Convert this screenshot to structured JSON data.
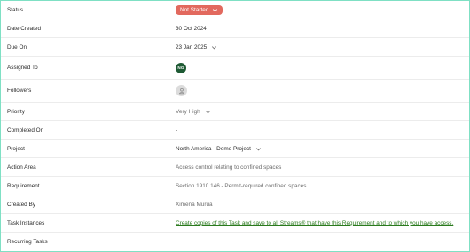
{
  "fields": {
    "status": {
      "label": "Status",
      "value": "Not Started",
      "badge_color": "#e2695e"
    },
    "date_created": {
      "label": "Date Created",
      "value": "30 Oct 2024"
    },
    "due_on": {
      "label": "Due On",
      "value": "23 Jan 2025"
    },
    "assigned_to": {
      "label": "Assigned To",
      "initials": "NG",
      "avatar_color": "#1e5a34"
    },
    "followers": {
      "label": "Followers",
      "icon": "user-placeholder-icon"
    },
    "priority": {
      "label": "Priority",
      "value": "Very High"
    },
    "completed_on": {
      "label": "Completed On",
      "value": "-"
    },
    "project": {
      "label": "Project",
      "value": "North America - Demo Project"
    },
    "action_area": {
      "label": "Action Area",
      "value": "Access control relating to confined spaces"
    },
    "requirement": {
      "label": "Requirement",
      "value": "Section 1910.146 - Permit-required confined spaces"
    },
    "created_by": {
      "label": "Created By",
      "value": "Ximena Murua"
    },
    "task_instances": {
      "label": "Task Instances",
      "link_text": "Create copies of this Task and save to all Streams® that have this Requirement and to which you have access.",
      "link_color": "#2a7a1d"
    },
    "recurring_tasks": {
      "label": "Recurring Tasks"
    }
  },
  "frame_border_color": "#7fe0c4"
}
